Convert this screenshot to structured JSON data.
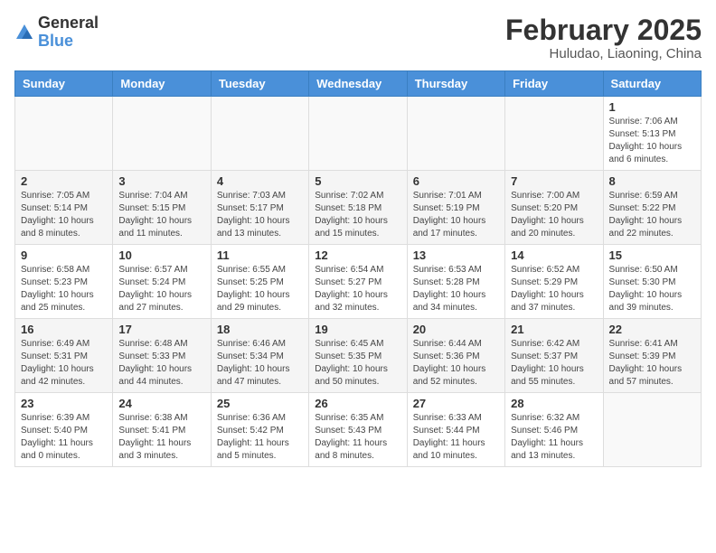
{
  "logo": {
    "general": "General",
    "blue": "Blue"
  },
  "header": {
    "month": "February 2025",
    "location": "Huludao, Liaoning, China"
  },
  "weekdays": [
    "Sunday",
    "Monday",
    "Tuesday",
    "Wednesday",
    "Thursday",
    "Friday",
    "Saturday"
  ],
  "weeks": [
    {
      "days": [
        {
          "num": "",
          "info": ""
        },
        {
          "num": "",
          "info": ""
        },
        {
          "num": "",
          "info": ""
        },
        {
          "num": "",
          "info": ""
        },
        {
          "num": "",
          "info": ""
        },
        {
          "num": "",
          "info": ""
        },
        {
          "num": "1",
          "info": "Sunrise: 7:06 AM\nSunset: 5:13 PM\nDaylight: 10 hours\nand 6 minutes."
        }
      ]
    },
    {
      "days": [
        {
          "num": "2",
          "info": "Sunrise: 7:05 AM\nSunset: 5:14 PM\nDaylight: 10 hours\nand 8 minutes."
        },
        {
          "num": "3",
          "info": "Sunrise: 7:04 AM\nSunset: 5:15 PM\nDaylight: 10 hours\nand 11 minutes."
        },
        {
          "num": "4",
          "info": "Sunrise: 7:03 AM\nSunset: 5:17 PM\nDaylight: 10 hours\nand 13 minutes."
        },
        {
          "num": "5",
          "info": "Sunrise: 7:02 AM\nSunset: 5:18 PM\nDaylight: 10 hours\nand 15 minutes."
        },
        {
          "num": "6",
          "info": "Sunrise: 7:01 AM\nSunset: 5:19 PM\nDaylight: 10 hours\nand 17 minutes."
        },
        {
          "num": "7",
          "info": "Sunrise: 7:00 AM\nSunset: 5:20 PM\nDaylight: 10 hours\nand 20 minutes."
        },
        {
          "num": "8",
          "info": "Sunrise: 6:59 AM\nSunset: 5:22 PM\nDaylight: 10 hours\nand 22 minutes."
        }
      ]
    },
    {
      "days": [
        {
          "num": "9",
          "info": "Sunrise: 6:58 AM\nSunset: 5:23 PM\nDaylight: 10 hours\nand 25 minutes."
        },
        {
          "num": "10",
          "info": "Sunrise: 6:57 AM\nSunset: 5:24 PM\nDaylight: 10 hours\nand 27 minutes."
        },
        {
          "num": "11",
          "info": "Sunrise: 6:55 AM\nSunset: 5:25 PM\nDaylight: 10 hours\nand 29 minutes."
        },
        {
          "num": "12",
          "info": "Sunrise: 6:54 AM\nSunset: 5:27 PM\nDaylight: 10 hours\nand 32 minutes."
        },
        {
          "num": "13",
          "info": "Sunrise: 6:53 AM\nSunset: 5:28 PM\nDaylight: 10 hours\nand 34 minutes."
        },
        {
          "num": "14",
          "info": "Sunrise: 6:52 AM\nSunset: 5:29 PM\nDaylight: 10 hours\nand 37 minutes."
        },
        {
          "num": "15",
          "info": "Sunrise: 6:50 AM\nSunset: 5:30 PM\nDaylight: 10 hours\nand 39 minutes."
        }
      ]
    },
    {
      "days": [
        {
          "num": "16",
          "info": "Sunrise: 6:49 AM\nSunset: 5:31 PM\nDaylight: 10 hours\nand 42 minutes."
        },
        {
          "num": "17",
          "info": "Sunrise: 6:48 AM\nSunset: 5:33 PM\nDaylight: 10 hours\nand 44 minutes."
        },
        {
          "num": "18",
          "info": "Sunrise: 6:46 AM\nSunset: 5:34 PM\nDaylight: 10 hours\nand 47 minutes."
        },
        {
          "num": "19",
          "info": "Sunrise: 6:45 AM\nSunset: 5:35 PM\nDaylight: 10 hours\nand 50 minutes."
        },
        {
          "num": "20",
          "info": "Sunrise: 6:44 AM\nSunset: 5:36 PM\nDaylight: 10 hours\nand 52 minutes."
        },
        {
          "num": "21",
          "info": "Sunrise: 6:42 AM\nSunset: 5:37 PM\nDaylight: 10 hours\nand 55 minutes."
        },
        {
          "num": "22",
          "info": "Sunrise: 6:41 AM\nSunset: 5:39 PM\nDaylight: 10 hours\nand 57 minutes."
        }
      ]
    },
    {
      "days": [
        {
          "num": "23",
          "info": "Sunrise: 6:39 AM\nSunset: 5:40 PM\nDaylight: 11 hours\nand 0 minutes."
        },
        {
          "num": "24",
          "info": "Sunrise: 6:38 AM\nSunset: 5:41 PM\nDaylight: 11 hours\nand 3 minutes."
        },
        {
          "num": "25",
          "info": "Sunrise: 6:36 AM\nSunset: 5:42 PM\nDaylight: 11 hours\nand 5 minutes."
        },
        {
          "num": "26",
          "info": "Sunrise: 6:35 AM\nSunset: 5:43 PM\nDaylight: 11 hours\nand 8 minutes."
        },
        {
          "num": "27",
          "info": "Sunrise: 6:33 AM\nSunset: 5:44 PM\nDaylight: 11 hours\nand 10 minutes."
        },
        {
          "num": "28",
          "info": "Sunrise: 6:32 AM\nSunset: 5:46 PM\nDaylight: 11 hours\nand 13 minutes."
        },
        {
          "num": "",
          "info": ""
        }
      ]
    }
  ]
}
